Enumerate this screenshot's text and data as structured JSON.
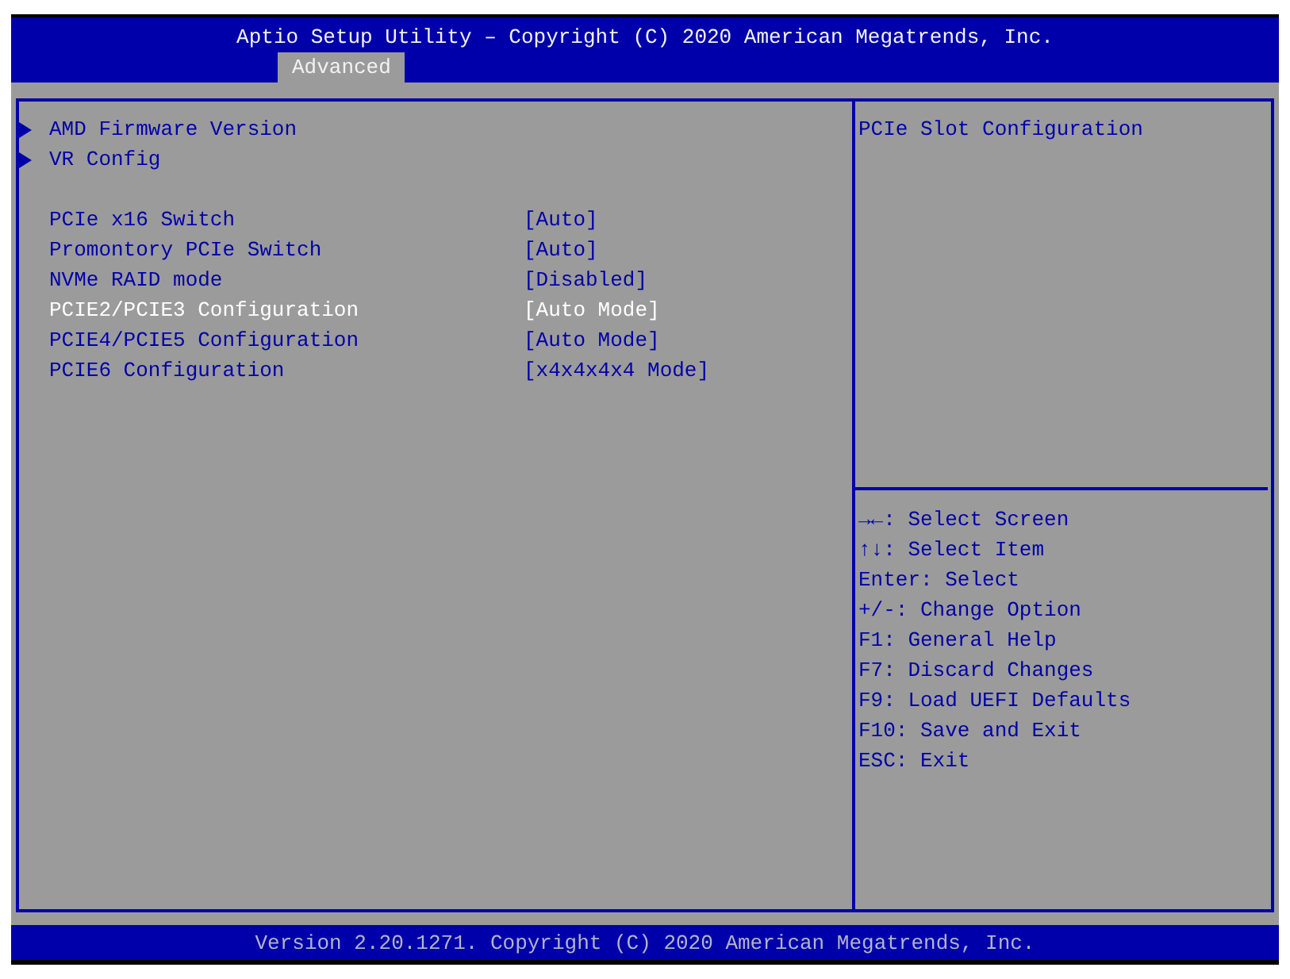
{
  "header": {
    "title": "Aptio Setup Utility – Copyright (C) 2020 American Megatrends, Inc.",
    "tabs": [
      {
        "label": "Advanced",
        "selected": true
      }
    ]
  },
  "submenus": [
    {
      "label": "AMD Firmware Version",
      "selected": false
    },
    {
      "label": "VR Config",
      "selected": false
    }
  ],
  "settings": [
    {
      "label": "PCIe x16 Switch",
      "value": "[Auto]",
      "selected": false
    },
    {
      "label": "Promontory PCIe Switch",
      "value": "[Auto]",
      "selected": false
    },
    {
      "label": "NVMe RAID mode",
      "value": "[Disabled]",
      "selected": false
    },
    {
      "label": "PCIE2/PCIE3 Configuration",
      "value": "[Auto Mode]",
      "selected": true
    },
    {
      "label": "PCIE4/PCIE5 Configuration",
      "value": "[Auto Mode]",
      "selected": false
    },
    {
      "label": "PCIE6 Configuration",
      "value": "[x4x4x4x4 Mode]",
      "selected": false
    }
  ],
  "help": {
    "description": "PCIe Slot Configuration",
    "keys": [
      "**→←**: Select Screen",
      "**↑↓**: Select Item",
      "Enter: Select",
      "+/-: Change Option",
      "F1: General Help",
      "F7: Discard Changes",
      "F9: Load UEFI Defaults",
      "F10: Save and Exit",
      "ESC: Exit"
    ]
  },
  "footer": {
    "text": "Version 2.20.1271. Copyright (C) 2020 American Megatrends, Inc."
  }
}
